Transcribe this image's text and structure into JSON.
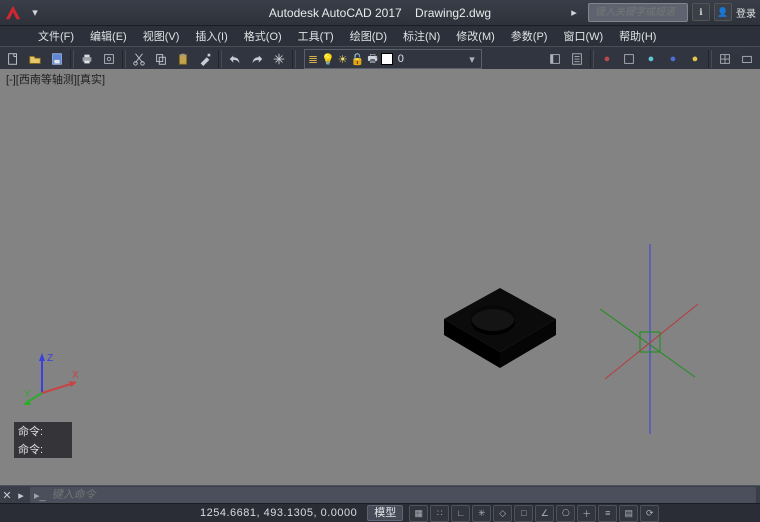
{
  "title": {
    "app": "Autodesk AutoCAD 2017",
    "doc": "Drawing2.dwg"
  },
  "search": {
    "placeholder": "键入关键字或短语"
  },
  "signin": "登录",
  "menu": {
    "file": "文件(F)",
    "edit": "编辑(E)",
    "view": "视图(V)",
    "insert": "插入(I)",
    "format": "格式(O)",
    "tools": "工具(T)",
    "draw": "绘图(D)",
    "dimension": "标注(N)",
    "modify": "修改(M)",
    "parametric": "参数(P)",
    "window": "窗口(W)",
    "help": "帮助(H)"
  },
  "layer": {
    "current": "0"
  },
  "viewport": {
    "label": "[-][西南等轴测][真实]"
  },
  "command": {
    "hist1": "命令:",
    "hist2": "命令:",
    "placeholder": "键入命令"
  },
  "status": {
    "coords": "1254.6681, 493.1305, 0.0000",
    "model_tab": "模型"
  },
  "ucs": {
    "x": "X",
    "y": "Y",
    "z": "Z"
  },
  "chart_data": null
}
